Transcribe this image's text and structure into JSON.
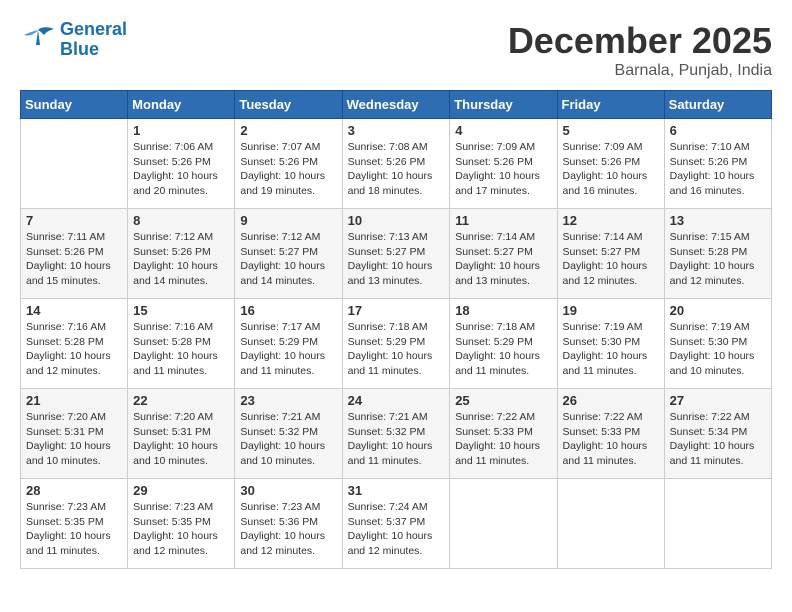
{
  "logo": {
    "line1": "General",
    "line2": "Blue"
  },
  "title": "December 2025",
  "location": "Barnala, Punjab, India",
  "days_of_week": [
    "Sunday",
    "Monday",
    "Tuesday",
    "Wednesday",
    "Thursday",
    "Friday",
    "Saturday"
  ],
  "weeks": [
    [
      {
        "day": "",
        "info": ""
      },
      {
        "day": "1",
        "info": "Sunrise: 7:06 AM\nSunset: 5:26 PM\nDaylight: 10 hours\nand 20 minutes."
      },
      {
        "day": "2",
        "info": "Sunrise: 7:07 AM\nSunset: 5:26 PM\nDaylight: 10 hours\nand 19 minutes."
      },
      {
        "day": "3",
        "info": "Sunrise: 7:08 AM\nSunset: 5:26 PM\nDaylight: 10 hours\nand 18 minutes."
      },
      {
        "day": "4",
        "info": "Sunrise: 7:09 AM\nSunset: 5:26 PM\nDaylight: 10 hours\nand 17 minutes."
      },
      {
        "day": "5",
        "info": "Sunrise: 7:09 AM\nSunset: 5:26 PM\nDaylight: 10 hours\nand 16 minutes."
      },
      {
        "day": "6",
        "info": "Sunrise: 7:10 AM\nSunset: 5:26 PM\nDaylight: 10 hours\nand 16 minutes."
      }
    ],
    [
      {
        "day": "7",
        "info": "Sunrise: 7:11 AM\nSunset: 5:26 PM\nDaylight: 10 hours\nand 15 minutes."
      },
      {
        "day": "8",
        "info": "Sunrise: 7:12 AM\nSunset: 5:26 PM\nDaylight: 10 hours\nand 14 minutes."
      },
      {
        "day": "9",
        "info": "Sunrise: 7:12 AM\nSunset: 5:27 PM\nDaylight: 10 hours\nand 14 minutes."
      },
      {
        "day": "10",
        "info": "Sunrise: 7:13 AM\nSunset: 5:27 PM\nDaylight: 10 hours\nand 13 minutes."
      },
      {
        "day": "11",
        "info": "Sunrise: 7:14 AM\nSunset: 5:27 PM\nDaylight: 10 hours\nand 13 minutes."
      },
      {
        "day": "12",
        "info": "Sunrise: 7:14 AM\nSunset: 5:27 PM\nDaylight: 10 hours\nand 12 minutes."
      },
      {
        "day": "13",
        "info": "Sunrise: 7:15 AM\nSunset: 5:28 PM\nDaylight: 10 hours\nand 12 minutes."
      }
    ],
    [
      {
        "day": "14",
        "info": "Sunrise: 7:16 AM\nSunset: 5:28 PM\nDaylight: 10 hours\nand 12 minutes."
      },
      {
        "day": "15",
        "info": "Sunrise: 7:16 AM\nSunset: 5:28 PM\nDaylight: 10 hours\nand 11 minutes."
      },
      {
        "day": "16",
        "info": "Sunrise: 7:17 AM\nSunset: 5:29 PM\nDaylight: 10 hours\nand 11 minutes."
      },
      {
        "day": "17",
        "info": "Sunrise: 7:18 AM\nSunset: 5:29 PM\nDaylight: 10 hours\nand 11 minutes."
      },
      {
        "day": "18",
        "info": "Sunrise: 7:18 AM\nSunset: 5:29 PM\nDaylight: 10 hours\nand 11 minutes."
      },
      {
        "day": "19",
        "info": "Sunrise: 7:19 AM\nSunset: 5:30 PM\nDaylight: 10 hours\nand 11 minutes."
      },
      {
        "day": "20",
        "info": "Sunrise: 7:19 AM\nSunset: 5:30 PM\nDaylight: 10 hours\nand 10 minutes."
      }
    ],
    [
      {
        "day": "21",
        "info": "Sunrise: 7:20 AM\nSunset: 5:31 PM\nDaylight: 10 hours\nand 10 minutes."
      },
      {
        "day": "22",
        "info": "Sunrise: 7:20 AM\nSunset: 5:31 PM\nDaylight: 10 hours\nand 10 minutes."
      },
      {
        "day": "23",
        "info": "Sunrise: 7:21 AM\nSunset: 5:32 PM\nDaylight: 10 hours\nand 10 minutes."
      },
      {
        "day": "24",
        "info": "Sunrise: 7:21 AM\nSunset: 5:32 PM\nDaylight: 10 hours\nand 11 minutes."
      },
      {
        "day": "25",
        "info": "Sunrise: 7:22 AM\nSunset: 5:33 PM\nDaylight: 10 hours\nand 11 minutes."
      },
      {
        "day": "26",
        "info": "Sunrise: 7:22 AM\nSunset: 5:33 PM\nDaylight: 10 hours\nand 11 minutes."
      },
      {
        "day": "27",
        "info": "Sunrise: 7:22 AM\nSunset: 5:34 PM\nDaylight: 10 hours\nand 11 minutes."
      }
    ],
    [
      {
        "day": "28",
        "info": "Sunrise: 7:23 AM\nSunset: 5:35 PM\nDaylight: 10 hours\nand 11 minutes."
      },
      {
        "day": "29",
        "info": "Sunrise: 7:23 AM\nSunset: 5:35 PM\nDaylight: 10 hours\nand 12 minutes."
      },
      {
        "day": "30",
        "info": "Sunrise: 7:23 AM\nSunset: 5:36 PM\nDaylight: 10 hours\nand 12 minutes."
      },
      {
        "day": "31",
        "info": "Sunrise: 7:24 AM\nSunset: 5:37 PM\nDaylight: 10 hours\nand 12 minutes."
      },
      {
        "day": "",
        "info": ""
      },
      {
        "day": "",
        "info": ""
      },
      {
        "day": "",
        "info": ""
      }
    ]
  ]
}
